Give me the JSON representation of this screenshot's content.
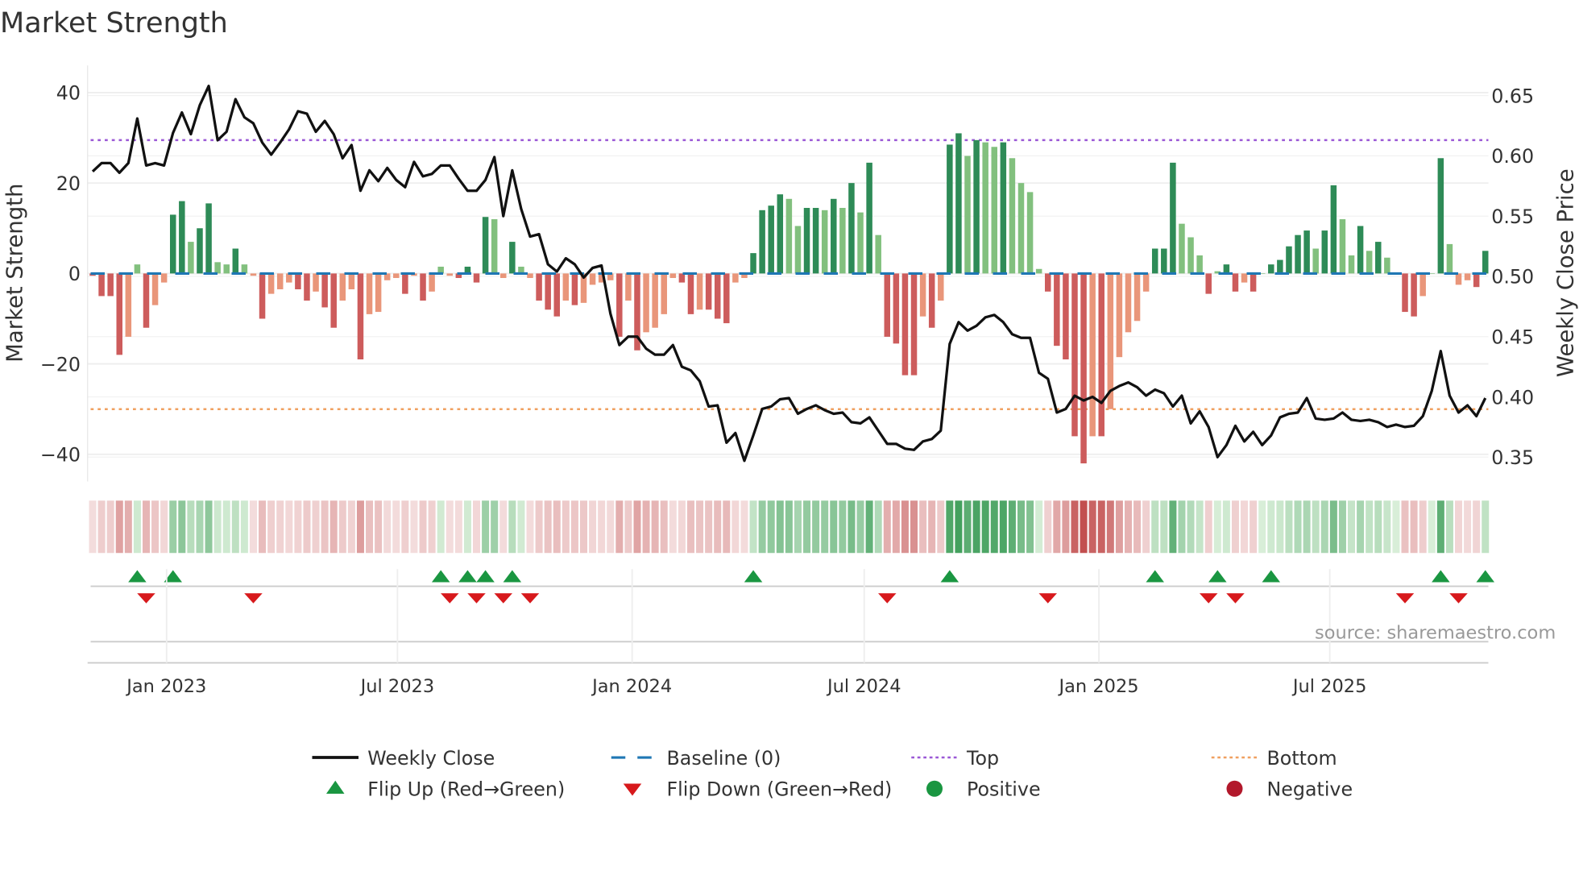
{
  "chart_data": {
    "type": "bar",
    "title": "Market Strength",
    "ylabel": "Market Strength",
    "y2label": "Weekly Close Price",
    "ylim": [
      -46,
      46
    ],
    "y2lim": [
      0.3298,
      0.675
    ],
    "yticks": [
      40,
      20,
      0,
      -20,
      -40
    ],
    "ytick_labels": [
      "40",
      "20",
      "0",
      "−20",
      "−40"
    ],
    "y2ticks": [
      0.65,
      0.6,
      0.55,
      0.5,
      0.45,
      0.4,
      0.35
    ],
    "y2tick_labels": [
      "0.65",
      "0.60",
      "0.55",
      "0.50",
      "0.45",
      "0.40",
      "0.35"
    ],
    "start_date": "2022-11-04",
    "xticks": [
      {
        "date": "2023-01-01",
        "label": "Jan 2023"
      },
      {
        "date": "2023-07-01",
        "label": "Jul 2023"
      },
      {
        "date": "2024-01-01",
        "label": "Jan 2024"
      },
      {
        "date": "2024-07-01",
        "label": "Jul 2024"
      },
      {
        "date": "2025-01-01",
        "label": "Jan 2025"
      },
      {
        "date": "2025-07-01",
        "label": "Jul 2025"
      }
    ],
    "top_threshold": 29.5,
    "bottom_threshold": -30,
    "grid": true,
    "legend_placement": "bottom-center",
    "strength": [
      -0.5,
      -5,
      -5,
      -18,
      -14,
      2,
      -12,
      -7,
      -2,
      13,
      16,
      7,
      10,
      15.5,
      2.5,
      2,
      5.5,
      2,
      -0.5,
      -10,
      -4.5,
      -3.5,
      -2,
      -3.5,
      -6,
      -4,
      -7.5,
      -12,
      -6,
      -3.5,
      -19,
      -9,
      -8.5,
      -1.5,
      -1,
      -4.5,
      -0.5,
      -6,
      -4,
      1.5,
      -0.5,
      -1,
      1.5,
      -2,
      12.5,
      12,
      -1,
      7,
      1.5,
      -1,
      -6,
      -8,
      -9.5,
      -6,
      -7,
      -6.5,
      -2.5,
      -2,
      -1.5,
      -14,
      -6,
      -17,
      -13,
      -12,
      -9,
      -1,
      -2,
      -9,
      -8,
      -8,
      -10,
      -11,
      -2,
      -1,
      4.5,
      14,
      15,
      17.5,
      16.5,
      10.5,
      14.5,
      14.5,
      14,
      16.5,
      14.5,
      20,
      13.5,
      24.5,
      8.5,
      -14,
      -15.5,
      -22.5,
      -22.5,
      -9.5,
      -12,
      -6,
      28.5,
      31,
      26,
      29.5,
      29,
      28,
      29,
      25.5,
      20,
      18,
      1,
      -4,
      -16,
      -19,
      -36,
      -42,
      -36,
      -36,
      -30,
      -18.5,
      -13,
      -10.5,
      -4,
      5.5,
      5.5,
      24.5,
      11,
      8,
      4,
      -4.5,
      0.5,
      2,
      -4,
      -2,
      -4,
      0,
      2,
      3,
      6,
      8.5,
      9.5,
      5.5,
      9.5,
      19.5,
      12,
      4,
      10.5,
      5,
      7,
      3.5,
      0,
      -8.5,
      -9.5,
      -5,
      0,
      25.5,
      6.5,
      -2.5,
      -1.5,
      -3,
      5
    ],
    "close": [
      0.587,
      0.594,
      0.594,
      0.586,
      0.594,
      0.631,
      0.592,
      0.594,
      0.592,
      0.619,
      0.636,
      0.618,
      0.642,
      0.658,
      0.613,
      0.62,
      0.647,
      0.632,
      0.627,
      0.611,
      0.601,
      0.611,
      0.622,
      0.637,
      0.635,
      0.62,
      0.629,
      0.618,
      0.598,
      0.609,
      0.571,
      0.588,
      0.579,
      0.59,
      0.58,
      0.574,
      0.595,
      0.583,
      0.585,
      0.592,
      0.592,
      0.581,
      0.571,
      0.571,
      0.58,
      0.599,
      0.55,
      0.588,
      0.556,
      0.533,
      0.535,
      0.51,
      0.504,
      0.515,
      0.51,
      0.499,
      0.507,
      0.509,
      0.469,
      0.443,
      0.45,
      0.45,
      0.44,
      0.435,
      0.435,
      0.443,
      0.425,
      0.422,
      0.413,
      0.392,
      0.393,
      0.362,
      0.37,
      0.347,
      0.368,
      0.39,
      0.392,
      0.398,
      0.399,
      0.386,
      0.39,
      0.393,
      0.389,
      0.386,
      0.387,
      0.379,
      0.378,
      0.383,
      0.372,
      0.361,
      0.361,
      0.357,
      0.356,
      0.363,
      0.365,
      0.372,
      0.444,
      0.462,
      0.455,
      0.459,
      0.466,
      0.468,
      0.462,
      0.452,
      0.449,
      0.449,
      0.42,
      0.415,
      0.387,
      0.39,
      0.401,
      0.397,
      0.4,
      0.395,
      0.405,
      0.409,
      0.412,
      0.408,
      0.401,
      0.406,
      0.403,
      0.392,
      0.401,
      0.378,
      0.388,
      0.375,
      0.35,
      0.36,
      0.376,
      0.363,
      0.371,
      0.36,
      0.368,
      0.383,
      0.386,
      0.387,
      0.399,
      0.382,
      0.381,
      0.382,
      0.387,
      0.381,
      0.38,
      0.381,
      0.379,
      0.375,
      0.377,
      0.375,
      0.376,
      0.384,
      0.405,
      0.438,
      0.401,
      0.387,
      0.393,
      0.384,
      0.399
    ],
    "source": "source: sharemaestro.com",
    "legend": [
      {
        "key": "weekly-close",
        "label": "Weekly Close"
      },
      {
        "key": "baseline",
        "label": "Baseline (0)"
      },
      {
        "key": "top",
        "label": "Top"
      },
      {
        "key": "bottom",
        "label": "Bottom"
      },
      {
        "key": "flip-up",
        "label": "Flip Up (Red→Green)"
      },
      {
        "key": "flip-down",
        "label": "Flip Down (Green→Red)"
      },
      {
        "key": "positive",
        "label": "Positive"
      },
      {
        "key": "negative",
        "label": "Negative"
      }
    ],
    "colors": {
      "pos_strong": "#2e8b57",
      "pos_weak": "#82c07e",
      "neg_strong": "#cd5c5c",
      "neg_weak": "#e9967a",
      "close": "#111111",
      "baseline": "#1f77b4",
      "top": "#9b59d6",
      "bottom": "#f0a060",
      "flip_up": "#1a9641",
      "flip_down": "#d7191c",
      "positive_dot": "#1a9641",
      "negative_dot": "#b2182b"
    }
  }
}
